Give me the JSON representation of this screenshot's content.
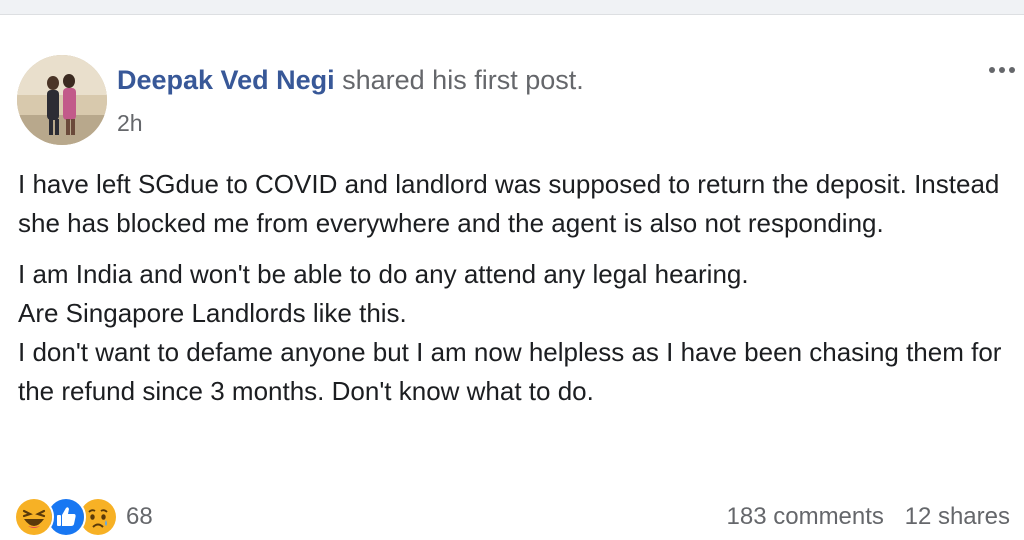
{
  "post": {
    "author": "Deepak Ved Negi",
    "action": "shared his first post.",
    "timestamp": "2h",
    "paragraphs": [
      "I have left SGdue to COVID and landlord was supposed to return the deposit. Instead she has blocked me from everywhere and the agent is also not responding.",
      "I am India and won't be able to do any attend any legal hearing. Are Singapore Landlords like this. I don't want to defame anyone but I am now helpless as I have been chasing them for the refund since 3 months. Don't know what to do."
    ],
    "lines_second": [
      "I am India and won't be able to do any attend any legal hearing.",
      "Are Singapore Landlords like this.",
      "I don't want to defame anyone but I am now helpless as I have been chasing them for the refund since 3 months. Don't know what to do."
    ]
  },
  "footer": {
    "reaction_count": "68",
    "comments": "183 comments",
    "shares": "12 shares"
  },
  "icons": {
    "more": "more-options-icon",
    "reactions": [
      "haha-icon",
      "like-icon",
      "sad-icon"
    ]
  },
  "colors": {
    "author": "#385898",
    "meta": "#65676b",
    "text": "#1c1e21",
    "like": "#1877f2",
    "emoji": "#f7b125"
  }
}
